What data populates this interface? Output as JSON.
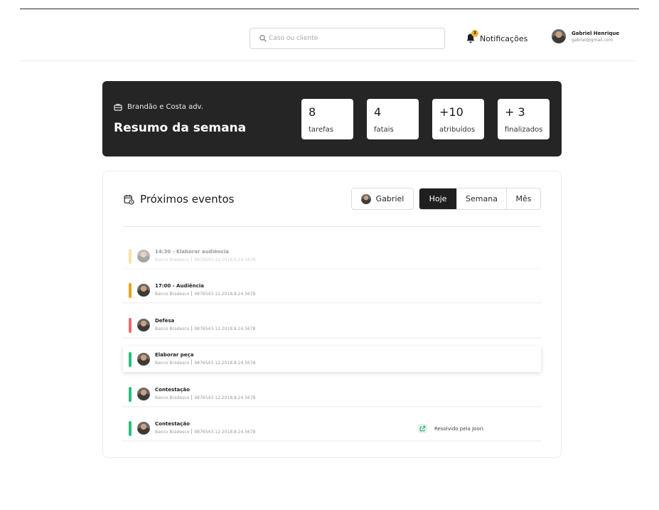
{
  "header": {
    "search_placeholder": "Caso ou cliente",
    "notifications_label": "Notificações",
    "notifications_count": "3",
    "user_name": "Gabriel Henrique",
    "user_email": "gabriel@gmail.com"
  },
  "summary": {
    "firm": "Brandão e Costa adv.",
    "title": "Resumo da semana",
    "stats": [
      {
        "value": "8",
        "label": "tarefas"
      },
      {
        "value": "4",
        "label": "fatais"
      },
      {
        "value": "+10",
        "label": "atribuídos"
      },
      {
        "value": "+ 3",
        "label": "finalizados"
      }
    ]
  },
  "events": {
    "title": "Próximos eventos",
    "person_filter": "Gabriel",
    "periods": [
      "Hoje",
      "Semana",
      "Mês"
    ],
    "active_period": "Hoje",
    "items": [
      {
        "title": "14:30 - Elaborar audiência",
        "client": "Banco Bradesco",
        "process": "9876543-12.2018.8.24.5678",
        "color": "#f2c14e",
        "faded": true
      },
      {
        "title": "17:00 - Audiência",
        "client": "Banco Bradesco",
        "process": "9876543-12.2018.8.24.5678",
        "color": "#e8a317"
      },
      {
        "title": "Defesa",
        "client": "Banco Bradesco",
        "process": "9876543-12.2018.8.24.5678",
        "color": "#ef6b6b"
      },
      {
        "title": "Elaborar peça",
        "client": "Banco Bradesco",
        "process": "9876543-12.2018.8.24.5678",
        "color": "#27c07d",
        "raised": true
      },
      {
        "title": "Contestação",
        "client": "Banco Bradesco",
        "process": "9876543-12.2018.8.24.5678",
        "color": "#27c07d"
      },
      {
        "title": "Contestação",
        "client": "Banco Bradesco",
        "process": "9876543-12.2018.8.24.5678",
        "color": "#27c07d",
        "resolved": "Resolvido pela Joori."
      }
    ]
  }
}
